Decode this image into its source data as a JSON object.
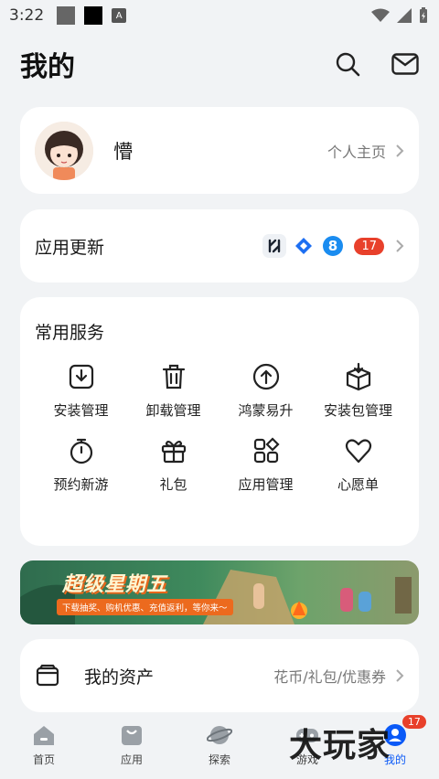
{
  "status_bar": {
    "time": "3:22"
  },
  "header": {
    "title": "我的"
  },
  "profile": {
    "name": "懵",
    "homepage_label": "个人主页"
  },
  "app_update": {
    "label": "应用更新",
    "badge": "17"
  },
  "services": {
    "title": "常用服务",
    "items": [
      {
        "label": "安装管理",
        "icon": "install-icon"
      },
      {
        "label": "卸载管理",
        "icon": "trash-icon"
      },
      {
        "label": "鸿蒙易升",
        "icon": "upgrade-icon"
      },
      {
        "label": "安装包管理",
        "icon": "package-icon"
      },
      {
        "label": "预约新游",
        "icon": "stopwatch-icon"
      },
      {
        "label": "礼包",
        "icon": "gift-icon"
      },
      {
        "label": "应用管理",
        "icon": "apps-icon"
      },
      {
        "label": "心愿单",
        "icon": "heart-icon"
      }
    ]
  },
  "banner": {
    "title": "超级星期五",
    "subtitle": "下载抽奖、购机优惠、充值返利，等你来～"
  },
  "assets": {
    "label": "我的资产",
    "detail": "花币/礼包/优惠券"
  },
  "bottom_nav": {
    "items": [
      {
        "label": "首页",
        "icon": "home-icon"
      },
      {
        "label": "应用",
        "icon": "shopping-bag-icon"
      },
      {
        "label": "探索",
        "icon": "planet-icon"
      },
      {
        "label": "游戏",
        "icon": "gamepad-icon"
      },
      {
        "label": "我的",
        "icon": "profile-icon",
        "active": true,
        "badge": "17"
      }
    ]
  },
  "watermark": "大玩家",
  "colors": {
    "accent": "#0a59f7",
    "badge": "#e8402b",
    "background": "#f1f3f5"
  }
}
